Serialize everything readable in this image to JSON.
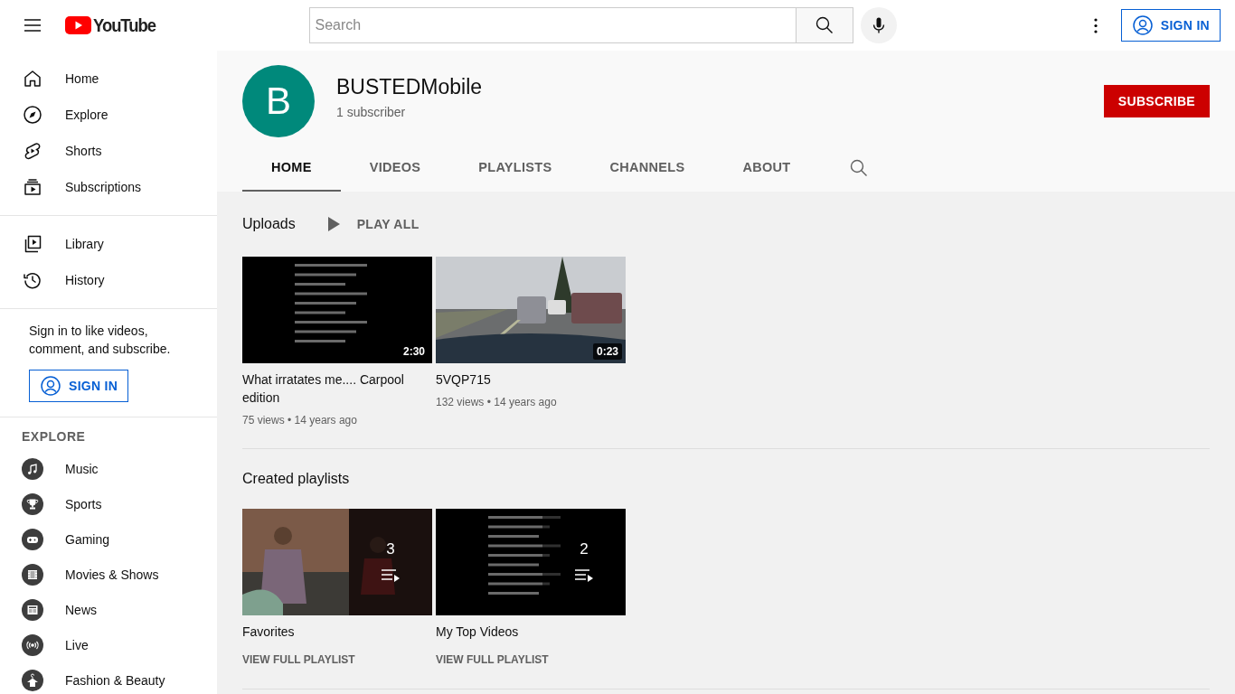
{
  "header": {
    "logo": "YouTube",
    "search": {
      "placeholder": "Search"
    },
    "sign_in_button": "SIGN IN"
  },
  "sidebar": {
    "main_items": [
      {
        "kind": "home",
        "label": "Home",
        "selected": false
      },
      {
        "kind": "explore",
        "label": "Explore",
        "selected": false
      },
      {
        "kind": "shorts",
        "label": "Shorts",
        "selected": false
      },
      {
        "kind": "subscriptions",
        "label": "Subscriptions",
        "selected": false
      }
    ],
    "library_items": [
      {
        "kind": "library",
        "label": "Library",
        "selected": false
      },
      {
        "kind": "history",
        "label": "History",
        "selected": false
      }
    ],
    "sign_in_prompt": "Sign in to like videos, comment, and subscribe.",
    "sign_in_button": "SIGN IN",
    "explore_heading": "EXPLORE",
    "explore_items": [
      {
        "kind": "music",
        "label": "Music",
        "selected": false
      },
      {
        "kind": "sports",
        "label": "Sports",
        "selected": false
      },
      {
        "kind": "gaming",
        "label": "Gaming",
        "selected": false
      },
      {
        "kind": "movies",
        "label": "Movies & Shows",
        "selected": false
      },
      {
        "kind": "news",
        "label": "News",
        "selected": false
      },
      {
        "kind": "live",
        "label": "Live",
        "selected": false
      },
      {
        "kind": "fashion",
        "label": "Fashion & Beauty",
        "selected": false
      }
    ]
  },
  "channel": {
    "avatar_letter": "B",
    "name": "BUSTEDMobile",
    "subscribers": "1 subscriber",
    "subscribe_button": "SUBSCRIBE",
    "tabs": [
      {
        "label": "HOME",
        "selected": true
      },
      {
        "label": "VIDEOS",
        "selected": false
      },
      {
        "label": "PLAYLISTS",
        "selected": false
      },
      {
        "label": "CHANNELS",
        "selected": false
      },
      {
        "label": "ABOUT",
        "selected": false
      }
    ]
  },
  "uploads": {
    "title": "Uploads",
    "play_all": "PLAY ALL",
    "videos": [
      {
        "title": "What irratates me.... Carpool edition",
        "duration": "2:30",
        "meta": "75 views • 14 years ago"
      },
      {
        "title": "5VQP715",
        "duration": "0:23",
        "meta": "132 views • 14 years ago"
      }
    ]
  },
  "playlists": {
    "title": "Created playlists",
    "items": [
      {
        "title": "Favorites",
        "count": "3",
        "link": "VIEW FULL PLAYLIST"
      },
      {
        "title": "My Top Videos",
        "count": "2",
        "link": "VIEW FULL PLAYLIST"
      }
    ]
  }
}
